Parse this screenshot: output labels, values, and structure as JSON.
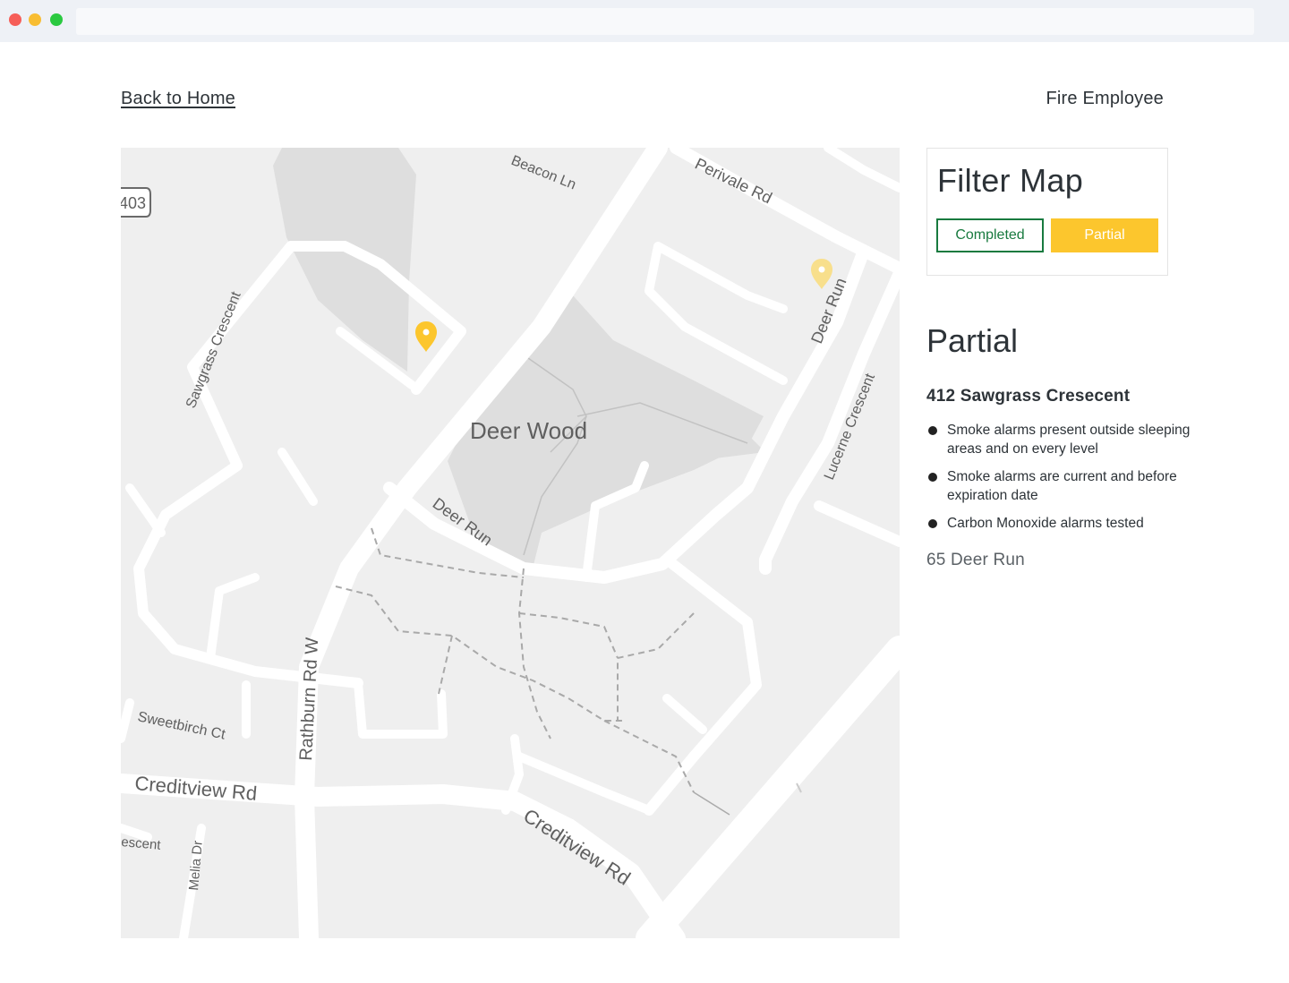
{
  "header": {
    "back_link": "Back to Home",
    "user_role": "Fire Employee"
  },
  "map": {
    "area_label": "Deer Wood",
    "highway_shield": "403",
    "street_labels": {
      "beacon": "Beacon Ln",
      "perivale": "Perivale Rd",
      "deer_run_ne": "Deer Run",
      "sawgrass": "Sawgrass Crescent",
      "deer_run_center": "Deer Run",
      "lucerne": "Lucerne Crescent",
      "rathburn": "Rathburn Rd W",
      "sweetbirch": "Sweetbirch Ct",
      "creditview_w": "Creditview Rd",
      "creditview_e": "Creditview Rd",
      "crescent_sw": "escent",
      "melia": "Melia Dr"
    },
    "markers": [
      {
        "name": "marker-sawgrass",
        "status": "partial",
        "state": "selected"
      },
      {
        "name": "marker-deer-run",
        "status": "partial",
        "state": "unselected"
      }
    ],
    "colors": {
      "land": "#efefef",
      "park": "#dedede",
      "road": "#ffffff",
      "marker_active": "#fcc62d",
      "marker_inactive": "#f8df8c"
    }
  },
  "filter": {
    "title": "Filter Map",
    "buttons": {
      "completed": "Completed",
      "partial": "Partial"
    },
    "colors": {
      "completed": "#187a3f",
      "partial": "#fcc62d"
    }
  },
  "details": {
    "heading": "Partial",
    "primary_address": "412 Sawgrass Cresecent",
    "checklist": [
      "Smoke alarms present outside sleeping areas and on every level",
      "Smoke alarms are current and before expiration date",
      "Carbon Monoxide alarms tested"
    ],
    "secondary_address": "65 Deer Run"
  }
}
